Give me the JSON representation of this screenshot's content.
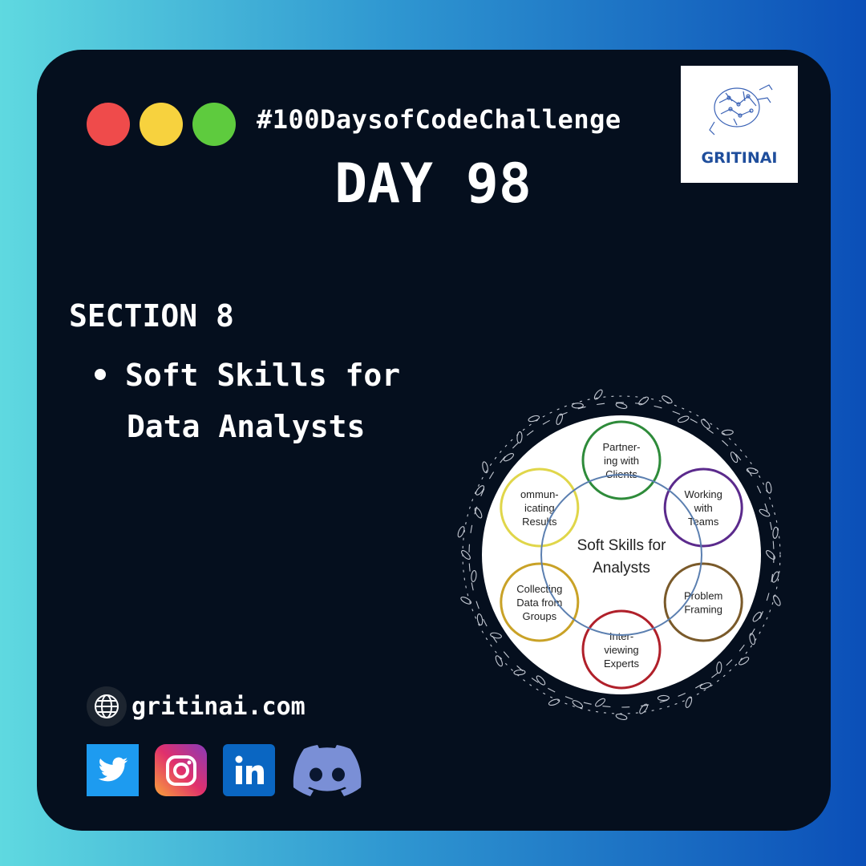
{
  "header": {
    "window_dots": [
      "#ef4b4b",
      "#f7d23e",
      "#5ecb3e"
    ],
    "hashtag": "#100DaysofCodeChallenge",
    "day_title": "DAY 98",
    "logo_text": "GRITINAI"
  },
  "content": {
    "section_title": "SECTION 8",
    "bullet_line1": "Soft Skills for",
    "bullet_line2": "Data Analysts"
  },
  "diagram": {
    "center_line1": "Soft Skills for",
    "center_line2": "Analysts",
    "nodes": [
      {
        "lines": [
          "Partner-",
          "ing with",
          "Clients"
        ],
        "color": "#2e8b3a"
      },
      {
        "lines": [
          "Working",
          "with",
          "Teams"
        ],
        "color": "#5b2a8c"
      },
      {
        "lines": [
          "Problem",
          "Framing"
        ],
        "color": "#7a5a2a"
      },
      {
        "lines": [
          "Inter-",
          "viewing",
          "Experts"
        ],
        "color": "#b0202a"
      },
      {
        "lines": [
          "Collecting",
          "Data from",
          "Groups"
        ],
        "color": "#c9a227"
      },
      {
        "lines": [
          "ommun-",
          "icating",
          "Results"
        ],
        "color": "#e0d64a"
      }
    ]
  },
  "footer": {
    "website": "gritinai.com",
    "socials": [
      "twitter-icon",
      "instagram-icon",
      "linkedin-icon",
      "discord-icon"
    ]
  }
}
